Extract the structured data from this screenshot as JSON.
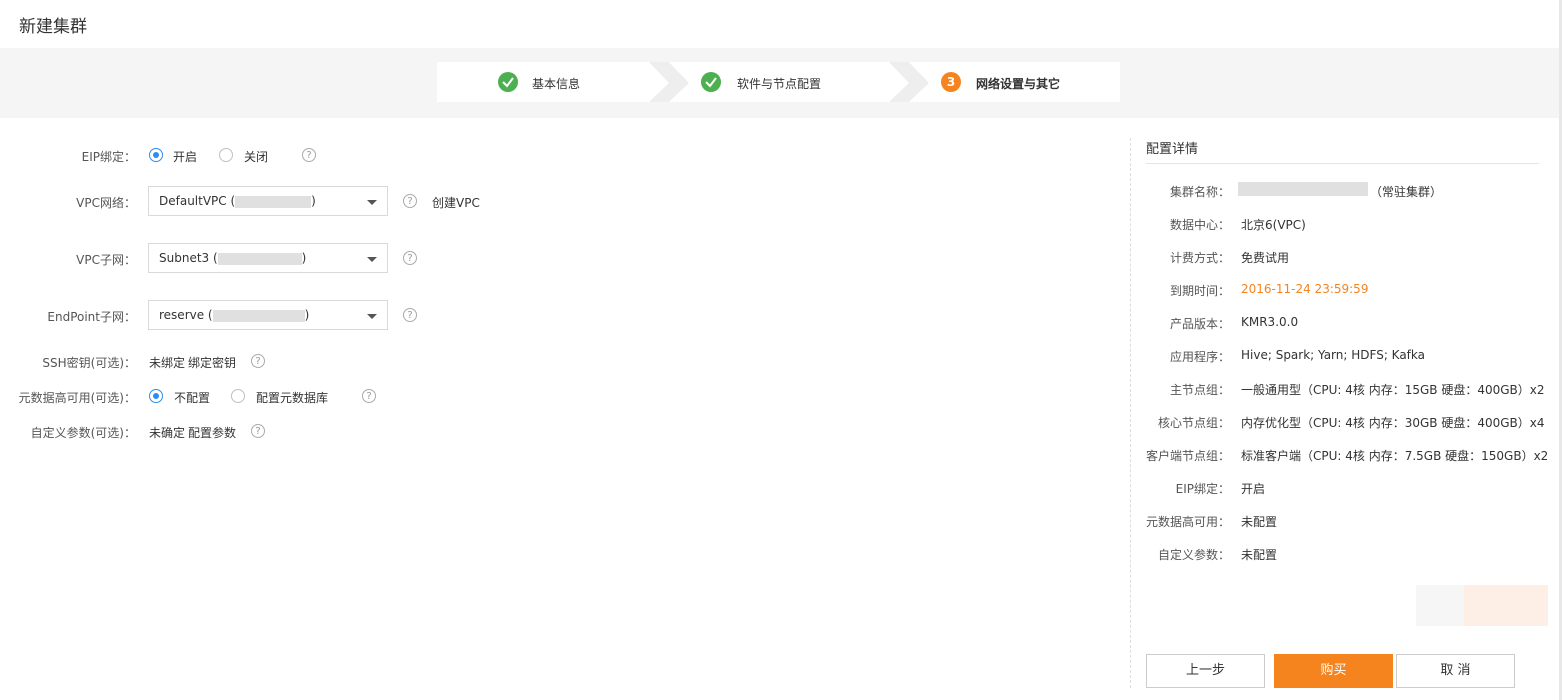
{
  "page": {
    "title": "新建集群"
  },
  "steps": [
    {
      "label": "基本信息",
      "state": "done"
    },
    {
      "label": "软件与节点配置",
      "state": "done"
    },
    {
      "label": "网络设置与其它",
      "state": "active",
      "number": "3"
    }
  ],
  "form": {
    "eip": {
      "label": "EIP绑定：",
      "options": [
        "开启",
        "关闭"
      ],
      "selected": "开启"
    },
    "vpc": {
      "label": "VPC网络：",
      "value_prefix": "DefaultVPC (",
      "value_suffix": ")",
      "create_link": "创建VPC"
    },
    "subnet": {
      "label": "VPC子网：",
      "value_prefix": "Subnet3 (",
      "value_suffix": ")"
    },
    "endpoint": {
      "label": "EndPoint子网：",
      "value_prefix": "reserve (",
      "value_suffix": ")"
    },
    "ssh": {
      "label": "SSH密钥(可选)：",
      "status": "未绑定",
      "link": "绑定密钥"
    },
    "metadata_ha": {
      "label": "元数据高可用(可选)：",
      "options": [
        "不配置",
        "配置元数据库"
      ],
      "selected": "不配置"
    },
    "custom_params": {
      "label": "自定义参数(可选)：",
      "status": "未确定",
      "link": "配置参数"
    },
    "help_glyph": "?"
  },
  "details": {
    "title": "配置详情",
    "rows": [
      {
        "label": "集群名称：",
        "value": "（常驻集群）"
      },
      {
        "label": "数据中心：",
        "value": "北京6(VPC)"
      },
      {
        "label": "计费方式：",
        "value": "免费试用"
      },
      {
        "label": "到期时间：",
        "value": "2016-11-24 23:59:59"
      },
      {
        "label": "产品版本：",
        "value": "KMR3.0.0"
      },
      {
        "label": "应用程序：",
        "value": "Hive; Spark; Yarn; HDFS; Kafka"
      },
      {
        "label": "主节点组：",
        "value": "一般通用型（CPU: 4核 内存：15GB 硬盘：400GB）x2"
      },
      {
        "label": "核心节点组：",
        "value": "内存优化型（CPU: 4核 内存：30GB 硬盘：400GB）x4"
      },
      {
        "label": "客户端节点组：",
        "value": "标准客户端（CPU: 4核 内存：7.5GB 硬盘：150GB）x2"
      },
      {
        "label": "EIP绑定：",
        "value": "开启"
      },
      {
        "label": "元数据高可用：",
        "value": "未配置"
      },
      {
        "label": "自定义参数：",
        "value": "未配置"
      }
    ]
  },
  "buttons": {
    "prev": "上一步",
    "buy": "购买",
    "cancel": "取 消"
  },
  "colors": {
    "accent": "#f5841f",
    "link": "#2b7cd3",
    "radio": "#2d8cf0",
    "done": "#4caf50"
  }
}
